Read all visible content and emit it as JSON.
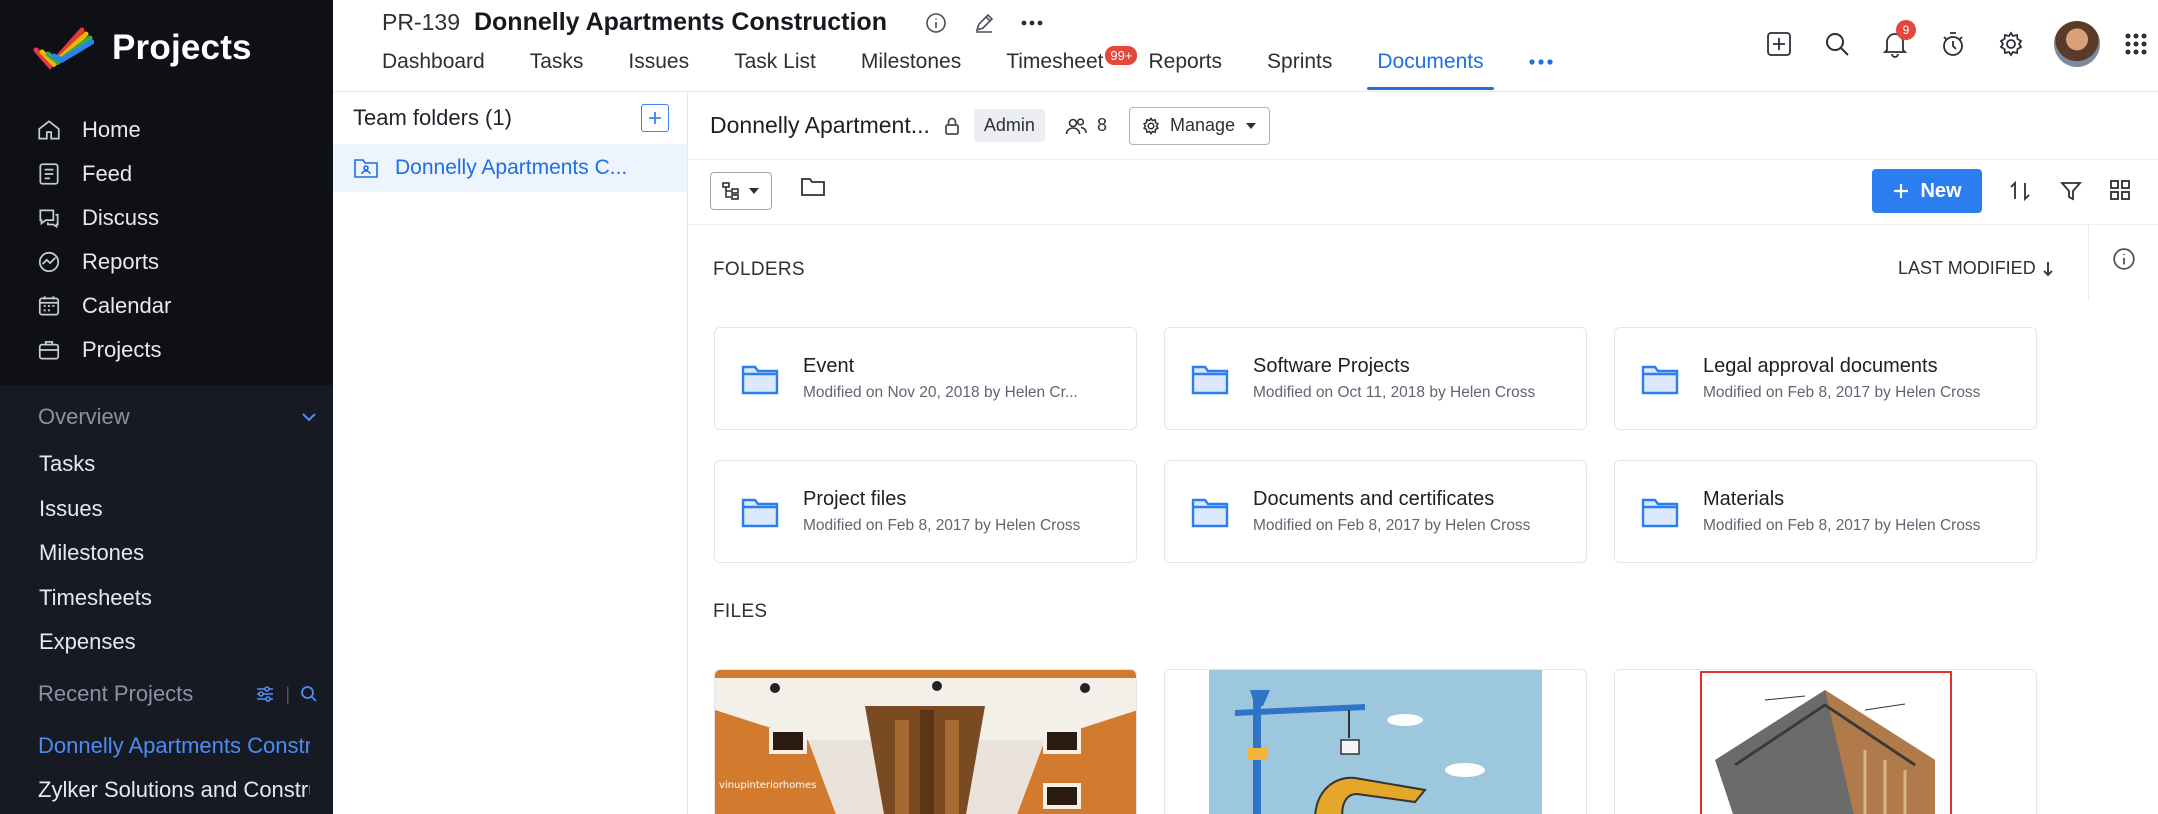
{
  "app": {
    "title": "Projects"
  },
  "sidebar": {
    "nav": [
      {
        "label": "Home",
        "icon": "home-icon"
      },
      {
        "label": "Feed",
        "icon": "feed-icon"
      },
      {
        "label": "Discuss",
        "icon": "discuss-icon"
      },
      {
        "label": "Reports",
        "icon": "reports-icon"
      },
      {
        "label": "Calendar",
        "icon": "calendar-icon"
      },
      {
        "label": "Projects",
        "icon": "projects-icon"
      }
    ],
    "overview_label": "Overview",
    "overview_items": [
      "Tasks",
      "Issues",
      "Milestones",
      "Timesheets",
      "Expenses"
    ],
    "recent_label": "Recent Projects",
    "recent_items": [
      "Donnelly Apartments Construction",
      "Zylker Solutions and Construction"
    ]
  },
  "header": {
    "project_id": "PR-139",
    "project_name": "Donnelly Apartments Construction",
    "tabs": [
      "Dashboard",
      "Tasks",
      "Issues",
      "Task List",
      "Milestones",
      "Timesheet",
      "Reports",
      "Sprints",
      "Documents"
    ],
    "active_tab": "Documents",
    "timesheet_badge": "99+",
    "notification_count": "9"
  },
  "team_panel": {
    "title": "Team folders (1)",
    "folder": "Donnelly Apartments C..."
  },
  "doc_header": {
    "name": "Donnelly Apartment...",
    "role": "Admin",
    "member_count": "8",
    "manage_label": "Manage"
  },
  "toolbar": {
    "new_label": "New"
  },
  "sections": {
    "folders_label": "FOLDERS",
    "files_label": "FILES",
    "sort_label": "LAST MODIFIED"
  },
  "folders": [
    {
      "name": "Event",
      "meta": "Modified on Nov 20, 2018 by Helen Cr..."
    },
    {
      "name": "Software Projects",
      "meta": "Modified on Oct 11, 2018 by Helen Cross"
    },
    {
      "name": "Legal approval documents",
      "meta": "Modified on Feb 8, 2017 by Helen Cross"
    },
    {
      "name": "Project files",
      "meta": "Modified on Feb 8, 2017 by Helen Cross"
    },
    {
      "name": "Documents and certificates",
      "meta": "Modified on Feb 8, 2017 by Helen Cross"
    },
    {
      "name": "Materials",
      "meta": "Modified on Feb 8, 2017 by Helen Cross"
    }
  ],
  "files": [
    {
      "thumbnail_caption": "vinupinteriorhomes"
    },
    {
      "thumbnail_caption": ""
    },
    {
      "thumbnail_caption": ""
    }
  ],
  "colors": {
    "accent": "#1d6fe4",
    "sidebar_bg": "#171a22",
    "badge_red": "#e4473b"
  }
}
